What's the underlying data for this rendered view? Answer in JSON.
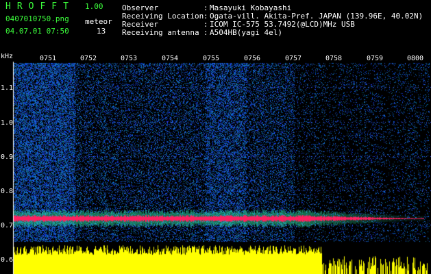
{
  "header": {
    "brand": "HROFFT",
    "version": "1.00",
    "filename": "0407010750.png",
    "datetime": "04.07.01 07:50",
    "meteor_label": "meteor",
    "meteor_count": "13",
    "fields": [
      {
        "label": "Observer",
        "value": "Masayuki Kobayashi"
      },
      {
        "label": "Receiving Location",
        "value": "Ogata-vill. Akita-Pref. JAPAN (139.96E, 40.02N)"
      },
      {
        "label": "Receiver",
        "value": "ICOM IC-575 53.7492(@LCD)MHz USB"
      },
      {
        "label": "Receiving antenna",
        "value": "A504HB(yagi 4el)"
      }
    ]
  },
  "plot": {
    "y_unit": "kHz",
    "y_ticks": [
      "1.1",
      "1.0",
      "0.9",
      "0.8",
      "0.7",
      "0.6"
    ],
    "x_ticks": [
      "0751",
      "0752",
      "0753",
      "0754",
      "0755",
      "0756",
      "0757",
      "0758",
      "0759",
      "0800"
    ],
    "colors": {
      "background": "#000000",
      "noise": "#1a3cff",
      "signal_band": "#ff2060",
      "band_halo": "#30e0a0",
      "level_bars": "#ffff00",
      "grid_dots": "#4060ff"
    }
  }
}
